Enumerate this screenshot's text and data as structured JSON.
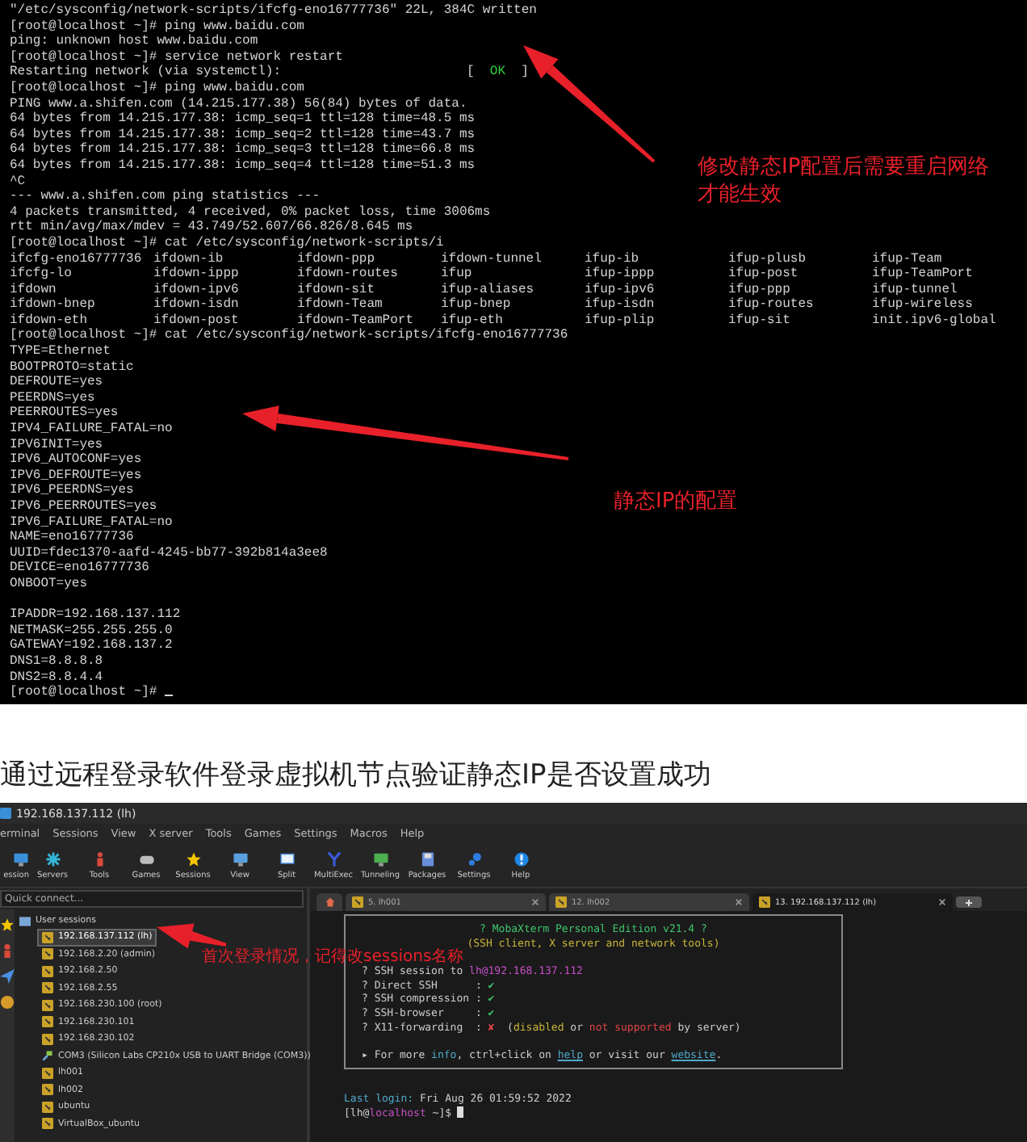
{
  "terminal": {
    "lines": [
      {
        "kind": "text",
        "text": "\"/etc/sysconfig/network-scripts/ifcfg-eno16777736\" 22L, 384C written"
      },
      {
        "kind": "text",
        "text": "[root@localhost ~]# ping www.baidu.com"
      },
      {
        "kind": "text",
        "text": "ping: unknown host www.baidu.com"
      },
      {
        "kind": "text",
        "text": "[root@localhost ~]# service network restart"
      },
      {
        "kind": "status",
        "text": "Restarting network (via systemctl):",
        "status": {
          "open": "[",
          "label": "OK",
          "close": "]",
          "ok": true
        }
      },
      {
        "kind": "text",
        "text": "[root@localhost ~]# ping www.baidu.com"
      },
      {
        "kind": "text",
        "text": "PING www.a.shifen.com (14.215.177.38) 56(84) bytes of data."
      },
      {
        "kind": "text",
        "text": "64 bytes from 14.215.177.38: icmp_seq=1 ttl=128 time=48.5 ms"
      },
      {
        "kind": "text",
        "text": "64 bytes from 14.215.177.38: icmp_seq=2 ttl=128 time=43.7 ms"
      },
      {
        "kind": "text",
        "text": "64 bytes from 14.215.177.38: icmp_seq=3 ttl=128 time=66.8 ms"
      },
      {
        "kind": "text",
        "text": "64 bytes from 14.215.177.38: icmp_seq=4 ttl=128 time=51.3 ms"
      },
      {
        "kind": "text",
        "text": "^C"
      },
      {
        "kind": "text",
        "text": "--- www.a.shifen.com ping statistics ---"
      },
      {
        "kind": "text",
        "text": "4 packets transmitted, 4 received, 0% packet loss, time 3006ms"
      },
      {
        "kind": "text",
        "text": "rtt min/avg/max/mdev = 43.749/52.607/66.826/8.645 ms"
      },
      {
        "kind": "text",
        "text": "[root@localhost ~]# cat /etc/sysconfig/network-scripts/i"
      },
      {
        "kind": "files",
        "cells": [
          "ifcfg-eno16777736",
          "ifdown-ib",
          "ifdown-ppp",
          "ifdown-tunnel",
          "ifup-ib",
          "ifup-plusb",
          "ifup-Team"
        ]
      },
      {
        "kind": "files",
        "cells": [
          "ifcfg-lo",
          "ifdown-ippp",
          "ifdown-routes",
          "ifup",
          "ifup-ippp",
          "ifup-post",
          "ifup-TeamPort"
        ]
      },
      {
        "kind": "files",
        "cells": [
          "ifdown",
          "ifdown-ipv6",
          "ifdown-sit",
          "ifup-aliases",
          "ifup-ipv6",
          "ifup-ppp",
          "ifup-tunnel"
        ]
      },
      {
        "kind": "files",
        "cells": [
          "ifdown-bnep",
          "ifdown-isdn",
          "ifdown-Team",
          "ifup-bnep",
          "ifup-isdn",
          "ifup-routes",
          "ifup-wireless"
        ]
      },
      {
        "kind": "files",
        "cells": [
          "ifdown-eth",
          "ifdown-post",
          "ifdown-TeamPort",
          "ifup-eth",
          "ifup-plip",
          "ifup-sit",
          "init.ipv6-global"
        ]
      },
      {
        "kind": "text",
        "text": "[root@localhost ~]# cat /etc/sysconfig/network-scripts/ifcfg-eno16777736"
      },
      {
        "kind": "text",
        "text": "TYPE=Ethernet"
      },
      {
        "kind": "text",
        "text": "BOOTPROTO=static"
      },
      {
        "kind": "text",
        "text": "DEFROUTE=yes"
      },
      {
        "kind": "text",
        "text": "PEERDNS=yes"
      },
      {
        "kind": "text",
        "text": "PEERROUTES=yes"
      },
      {
        "kind": "text",
        "text": "IPV4_FAILURE_FATAL=no"
      },
      {
        "kind": "text",
        "text": "IPV6INIT=yes"
      },
      {
        "kind": "text",
        "text": "IPV6_AUTOCONF=yes"
      },
      {
        "kind": "text",
        "text": "IPV6_DEFROUTE=yes"
      },
      {
        "kind": "text",
        "text": "IPV6_PEERDNS=yes"
      },
      {
        "kind": "text",
        "text": "IPV6_PEERROUTES=yes"
      },
      {
        "kind": "text",
        "text": "IPV6_FAILURE_FATAL=no"
      },
      {
        "kind": "text",
        "text": "NAME=eno16777736"
      },
      {
        "kind": "text",
        "text": "UUID=fdec1370-aafd-4245-bb77-392b814a3ee8"
      },
      {
        "kind": "text",
        "text": "DEVICE=eno16777736"
      },
      {
        "kind": "text",
        "text": "ONBOOT=yes"
      },
      {
        "kind": "blank"
      },
      {
        "kind": "text",
        "text": "IPADDR=192.168.137.112"
      },
      {
        "kind": "text",
        "text": "NETMASK=255.255.255.0"
      },
      {
        "kind": "text",
        "text": "GATEWAY=192.168.137.2"
      },
      {
        "kind": "text",
        "text": "DNS1=8.8.8.8"
      },
      {
        "kind": "text",
        "text": "DNS2=8.8.4.4"
      },
      {
        "kind": "prompt",
        "text": "[root@localhost ~]# "
      }
    ],
    "annotations": [
      {
        "lines": [
          "修改静态IP配置后需要重启网络",
          "才能生效"
        ]
      },
      {
        "lines": [
          "静态IP的配置"
        ]
      }
    ]
  },
  "caption": "通过远程登录软件登录虚拟机节点验证静态IP是否设置成功",
  "mobaxterm": {
    "title": "192.168.137.112 (lh)",
    "menu": [
      "erminal",
      "Sessions",
      "View",
      "X server",
      "Tools",
      "Games",
      "Settings",
      "Macros",
      "Help"
    ],
    "toolbar": [
      "ession",
      "Servers",
      "Tools",
      "Games",
      "Sessions",
      "View",
      "Split",
      "MultiExec",
      "Tunneling",
      "Packages",
      "Settings",
      "Help"
    ],
    "quick_connect": {
      "placeholder": "Quick connect..."
    },
    "tabs": [
      {
        "kind": "home",
        "selected": false
      },
      {
        "kind": "session",
        "label": "5. lh001",
        "selected": false
      },
      {
        "kind": "session",
        "label": "12. lh002",
        "selected": false
      },
      {
        "kind": "session",
        "label": "13. 192.168.137.112 (lh)",
        "selected": true
      },
      {
        "kind": "new",
        "selected": false
      }
    ],
    "sessions": {
      "label": "User sessions",
      "children": [
        {
          "kind": "ssh",
          "label": "192.168.137.112 (lh)",
          "selected": true
        },
        {
          "kind": "ssh",
          "label": "192.168.2.20 (admin)",
          "selected": false
        },
        {
          "kind": "ssh",
          "label": "192.168.2.50",
          "selected": false
        },
        {
          "kind": "ssh",
          "label": "192.168.2.55",
          "selected": false
        },
        {
          "kind": "ssh",
          "label": "192.168.230.100 (root)",
          "selected": false
        },
        {
          "kind": "ssh",
          "label": "192.168.230.101",
          "selected": false
        },
        {
          "kind": "ssh",
          "label": "192.168.230.102",
          "selected": false
        },
        {
          "kind": "serial",
          "label": "COM3  (Silicon Labs CP210x USB to UART Bridge (COM3))",
          "selected": false
        },
        {
          "kind": "ssh",
          "label": "lh001",
          "selected": false
        },
        {
          "kind": "ssh",
          "label": "lh002",
          "selected": false
        },
        {
          "kind": "ssh",
          "label": "ubuntu",
          "selected": false
        },
        {
          "kind": "ssh",
          "label": "VirtualBox_ubuntu",
          "selected": false
        }
      ]
    },
    "terminal": {
      "banner_title": "? MobaXterm Personal Edition v21.4 ?",
      "banner_subtitle": "(SSH client, X server and network tools)",
      "session_prefix": "? SSH session to ",
      "session_target": "lh@192.168.137.112",
      "features": [
        {
          "label": "? Direct SSH      :",
          "mark": "✔",
          "on": true
        },
        {
          "label": "? SSH compression :",
          "mark": "✔",
          "on": true
        },
        {
          "label": "? SSH-browser     :",
          "mark": "✔",
          "on": true
        },
        {
          "label": "? X11-forwarding  :",
          "mark": "✘",
          "on": false,
          "note": [
            {
              "kind": "plain",
              "text": "("
            },
            {
              "kind": "warn",
              "text": "disabled"
            },
            {
              "kind": "plain",
              "text": " or "
            },
            {
              "kind": "error",
              "text": "not supported"
            },
            {
              "kind": "plain",
              "text": " by server)"
            }
          ]
        }
      ],
      "info": [
        {
          "kind": "plain",
          "text": "▸ For more "
        },
        {
          "kind": "accent",
          "text": "info"
        },
        {
          "kind": "plain",
          "text": ", ctrl+click on "
        },
        {
          "kind": "link",
          "text": "help"
        },
        {
          "kind": "plain",
          "text": " or visit our "
        },
        {
          "kind": "link",
          "text": "website"
        },
        {
          "kind": "plain",
          "text": "."
        }
      ],
      "last_login_label": "Last login:",
      "last_login_value": "Fri Aug 26 01:59:52 2022",
      "prompt": [
        {
          "kind": "plain",
          "text": "[lh@"
        },
        {
          "kind": "host",
          "text": "localhost"
        },
        {
          "kind": "plain",
          "text": " ~]$ "
        }
      ]
    },
    "annotation": "首次登录情况，记得改sessions名称"
  }
}
